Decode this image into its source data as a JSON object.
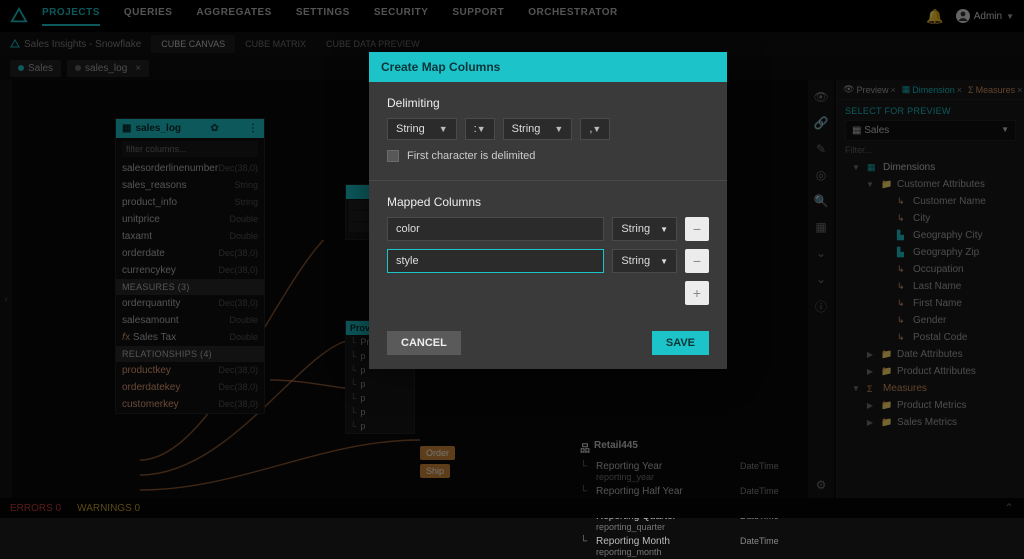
{
  "nav": {
    "items": [
      "PROJECTS",
      "QUERIES",
      "AGGREGATES",
      "SETTINGS",
      "SECURITY",
      "SUPPORT",
      "ORCHESTRATOR"
    ],
    "active": 0,
    "user_label": "Admin"
  },
  "subheader": {
    "crumb": "Sales Insights - Snowflake",
    "tabs": [
      "CUBE CANVAS",
      "CUBE MATRIX",
      "CUBE DATA PREVIEW"
    ],
    "active": 0
  },
  "open_tabs": [
    {
      "label": "Sales",
      "closable": false
    },
    {
      "label": "sales_log",
      "closable": true
    }
  ],
  "sales_log_node": {
    "title": "sales_log",
    "filter_placeholder": "filter columns...",
    "columns": [
      {
        "name": "salesorderlinenumber",
        "type": "Dec(38,0)"
      },
      {
        "name": "sales_reasons",
        "type": "String"
      },
      {
        "name": "product_info",
        "type": "String"
      },
      {
        "name": "unitprice",
        "type": "Double"
      },
      {
        "name": "taxamt",
        "type": "Double"
      },
      {
        "name": "orderdate",
        "type": "Dec(38,0)"
      },
      {
        "name": "currencykey",
        "type": "Dec(38,0)"
      }
    ],
    "measures_header": "MEASURES (3)",
    "measures": [
      {
        "name": "orderquantity",
        "type": "Dec(38,0)"
      },
      {
        "name": "salesamount",
        "type": "Double"
      },
      {
        "name": "Sales Tax",
        "type": "Double",
        "fx": true
      }
    ],
    "relationships_header": "RELATIONSHIPS (4)",
    "relationships": [
      {
        "name": "productkey",
        "type": "Dec(38,0)"
      },
      {
        "name": "orderdatekey",
        "type": "Dec(38,0)"
      },
      {
        "name": "customerkey",
        "type": "Dec(38,0)"
      }
    ]
  },
  "mini_node_title": "Prov",
  "mini_node_rows": [
    "Proc",
    "p",
    "p",
    "p",
    "p",
    "p",
    "p"
  ],
  "pill_a": "Order",
  "pill_b": "Ship",
  "retail_node": {
    "title": "Retail445",
    "rows": [
      {
        "l1": "Reporting Year",
        "l2": "reporting_year",
        "t": "DateTime"
      },
      {
        "l1": "Reporting Half Year",
        "l2": "reporting_half_year",
        "t": "DateTime"
      },
      {
        "l1": "Reporting Quarter",
        "l2": "reporting_quarter",
        "t": "DateTime"
      },
      {
        "l1": "Reporting Month",
        "l2": "reporting_month",
        "t": "DateTime"
      }
    ]
  },
  "preview": {
    "tabs": {
      "preview": "Preview",
      "dimension": "Dimension",
      "measures": "Measures"
    },
    "select_label": "SELECT FOR PREVIEW",
    "selected": "Sales",
    "filter": "Filter...",
    "dimensions_label": "Dimensions",
    "dim_groups": [
      {
        "name": "Customer Attributes",
        "items": [
          "Customer Name",
          "City",
          "Geography City",
          "Geography Zip",
          "Occupation",
          "Last Name",
          "First Name",
          "Gender",
          "Postal Code"
        ]
      },
      {
        "name": "Date Attributes",
        "items": []
      },
      {
        "name": "Product Attributes",
        "items": []
      }
    ],
    "measures_label": "Measures",
    "msr_groups": [
      "Product Metrics",
      "Sales Metrics"
    ]
  },
  "statusbar": {
    "errors": "ERRORS 0",
    "warnings": "WARNINGS 0"
  },
  "modal": {
    "title": "Create Map Columns",
    "delimiting_label": "Delimiting",
    "delim_type1": "String",
    "delim_sep1": ":",
    "delim_type2": "String",
    "delim_sep2": ",",
    "first_char_label": "First character is delimited",
    "mapped_label": "Mapped Columns",
    "rows": [
      {
        "name": "color",
        "type": "String"
      },
      {
        "name": "style",
        "type": "String",
        "focused": true
      }
    ],
    "cancel": "CANCEL",
    "save": "SAVE"
  }
}
